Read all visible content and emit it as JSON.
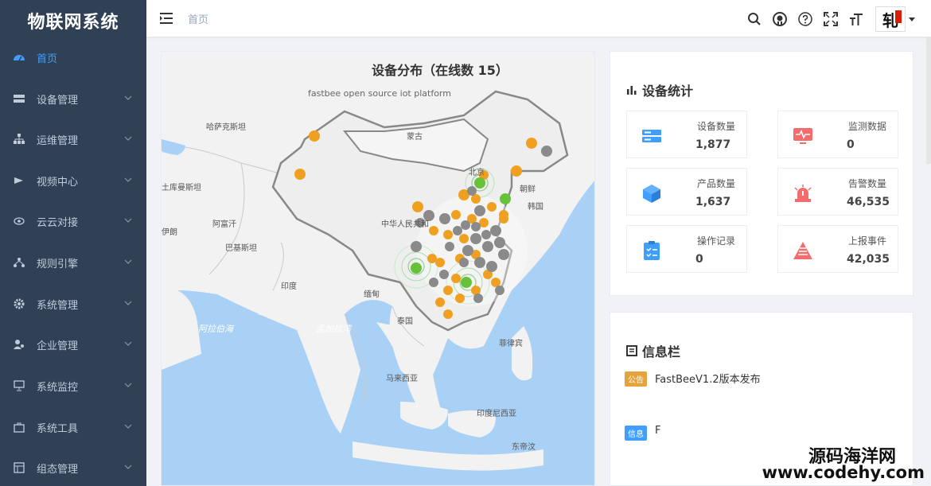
{
  "app": {
    "title": "物联网系统"
  },
  "sidebar": {
    "items": [
      {
        "label": "首页",
        "icon": "dashboard-icon",
        "active": true
      },
      {
        "label": "设备管理",
        "icon": "device-icon"
      },
      {
        "label": "运维管理",
        "icon": "tree-icon"
      },
      {
        "label": "视频中心",
        "icon": "video-icon"
      },
      {
        "label": "云云对接",
        "icon": "eye-icon"
      },
      {
        "label": "规则引擎",
        "icon": "share-icon"
      },
      {
        "label": "系统管理",
        "icon": "gear-icon"
      },
      {
        "label": "企业管理",
        "icon": "user-group-icon"
      },
      {
        "label": "系统监控",
        "icon": "monitor-icon"
      },
      {
        "label": "系统工具",
        "icon": "toolbox-icon"
      },
      {
        "label": "组态管理",
        "icon": "layout-icon"
      }
    ]
  },
  "header": {
    "breadcrumb": "首页",
    "icons": [
      "search-icon",
      "github-icon",
      "question-icon",
      "fullscreen-icon",
      "font-size-icon"
    ],
    "avatar_text": "轧"
  },
  "map": {
    "title": "设备分布（在线数 15）",
    "subtitle": "fastbee open source iot platform",
    "labels": [
      "哈萨克斯坦",
      "蒙古",
      "北京",
      "朝鲜",
      "韩国",
      "中华人民共和",
      "阿富汗",
      "巴基斯坦",
      "印度",
      "缅甸",
      "泰国",
      "菲律宾",
      "马来西亚",
      "印度尼西亚",
      "土库曼斯坦",
      "伊朗",
      "东帝汶"
    ],
    "seas": [
      "阿拉伯海",
      "孟加拉湾"
    ]
  },
  "stats": {
    "title": "设备统计",
    "tiles": [
      {
        "label": "设备数量",
        "value": "1,877",
        "icon": "server-icon",
        "color": "#409eff"
      },
      {
        "label": "监测数据",
        "value": "0",
        "icon": "monitor-pulse-icon",
        "color": "#f56c6c"
      },
      {
        "label": "产品数量",
        "value": "1,637",
        "icon": "cube-icon",
        "color": "#409eff"
      },
      {
        "label": "告警数量",
        "value": "46,535",
        "icon": "alarm-icon",
        "color": "#f56c6c"
      },
      {
        "label": "操作记录",
        "value": "0",
        "icon": "clipboard-icon",
        "color": "#409eff"
      },
      {
        "label": "上报事件",
        "value": "42,035",
        "icon": "warning-icon",
        "color": "#f56c6c"
      }
    ]
  },
  "notices": {
    "title": "信息栏",
    "items": [
      {
        "tag": "公告",
        "text": "FastBeeV1.2版本发布"
      },
      {
        "tag": "信息",
        "text": "F"
      }
    ]
  },
  "watermark": {
    "line1": "源码海洋网",
    "line2": "www.codehy.com"
  }
}
